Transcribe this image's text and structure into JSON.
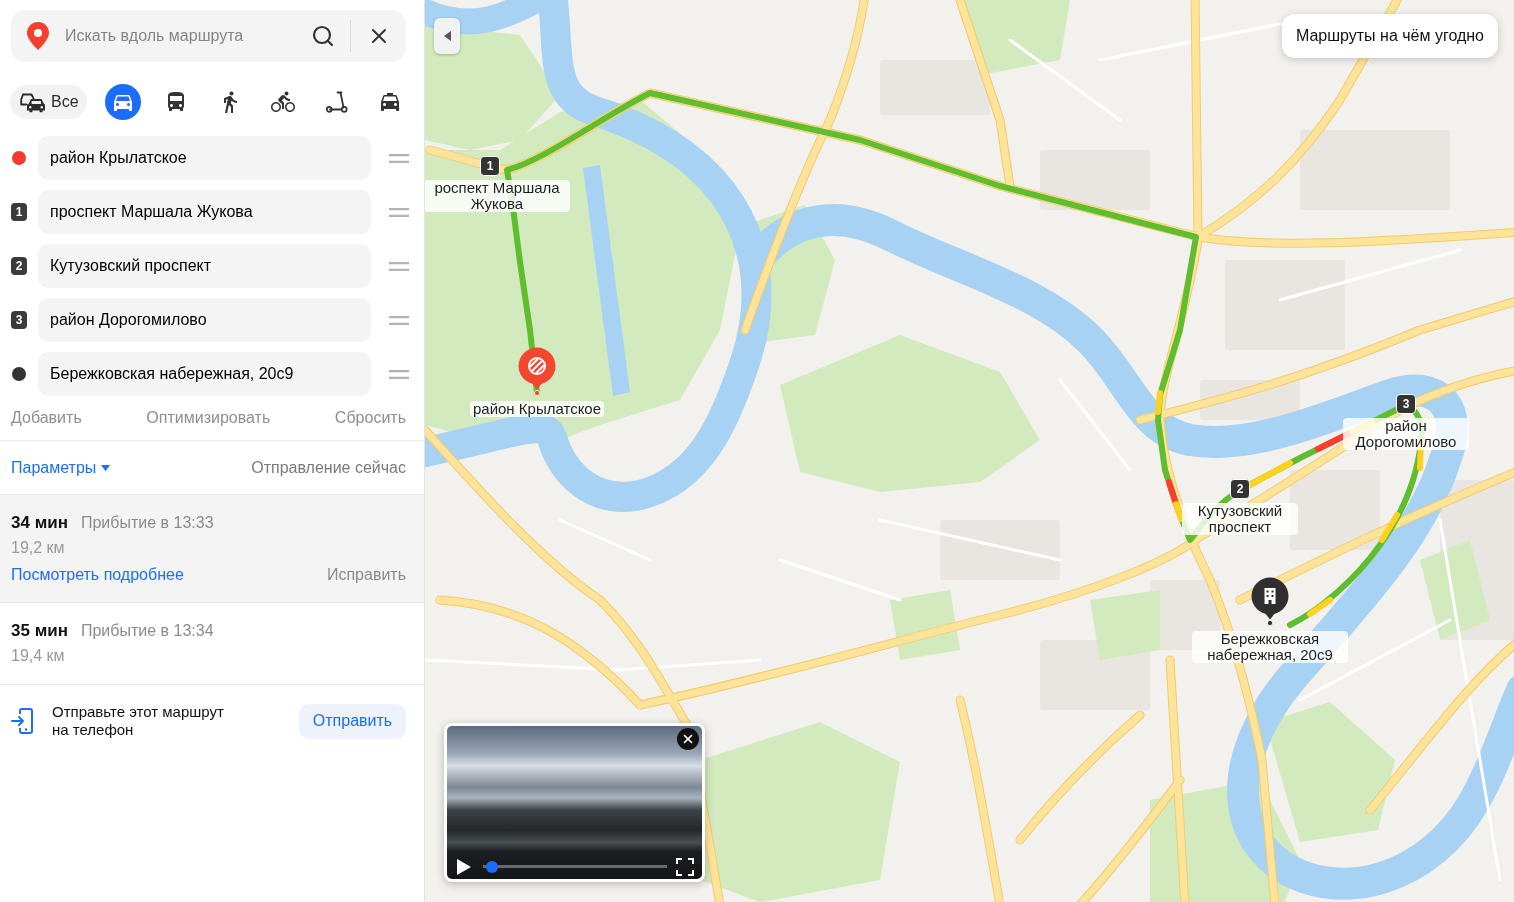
{
  "search": {
    "placeholder": "Искать вдоль маршрута"
  },
  "transport_modes": [
    {
      "kind": "all",
      "label": "Все",
      "selected": false
    },
    {
      "kind": "car",
      "selected": true
    },
    {
      "kind": "bus",
      "selected": false
    },
    {
      "kind": "walk",
      "selected": false
    },
    {
      "kind": "bike",
      "selected": false
    },
    {
      "kind": "scooter",
      "selected": false
    },
    {
      "kind": "taxi",
      "selected": false
    }
  ],
  "waypoints": [
    {
      "kind": "start",
      "value": "район Крылатское"
    },
    {
      "kind": "stop",
      "number": "1",
      "value": "проспект Маршала Жукова"
    },
    {
      "kind": "stop",
      "number": "2",
      "value": "Кутузовский проспект"
    },
    {
      "kind": "stop",
      "number": "3",
      "value": "район Дорогомилово"
    },
    {
      "kind": "end",
      "value": "Бережковская набережная, 20с9"
    }
  ],
  "route_actions": [
    "Добавить",
    "Оптимизировать",
    "Сбросить"
  ],
  "options": {
    "parameters": "Параметры",
    "departure": "Отправление сейчас"
  },
  "routes": [
    {
      "duration": "34 мин",
      "arrival": "Прибытие в 13:33",
      "distance": "19,2 км",
      "selected": true,
      "links": [
        "Посмотреть подробнее",
        "Исправить"
      ]
    },
    {
      "duration": "35 мин",
      "arrival": "Прибытие в 13:34",
      "distance": "19,4 км",
      "selected": false
    }
  ],
  "send_to_phone": {
    "text": "Отправьте этот маршрут на телефон",
    "button": "Отправить"
  },
  "map": {
    "promo_button": "Маршруты на чём угодно",
    "waypoints": [
      {
        "kind": "start",
        "label": "район Крылатское"
      },
      {
        "kind": "stop",
        "number": "1",
        "label": "роспект Маршала Жукова"
      },
      {
        "kind": "stop",
        "number": "2",
        "label": "Кутузовский проспект"
      },
      {
        "kind": "stop",
        "number": "3",
        "label": "район Дорогомилово"
      },
      {
        "kind": "end",
        "label": "Бережковская набережная, 20с9"
      }
    ],
    "video": {
      "playing": false,
      "level": 0.02
    }
  }
}
